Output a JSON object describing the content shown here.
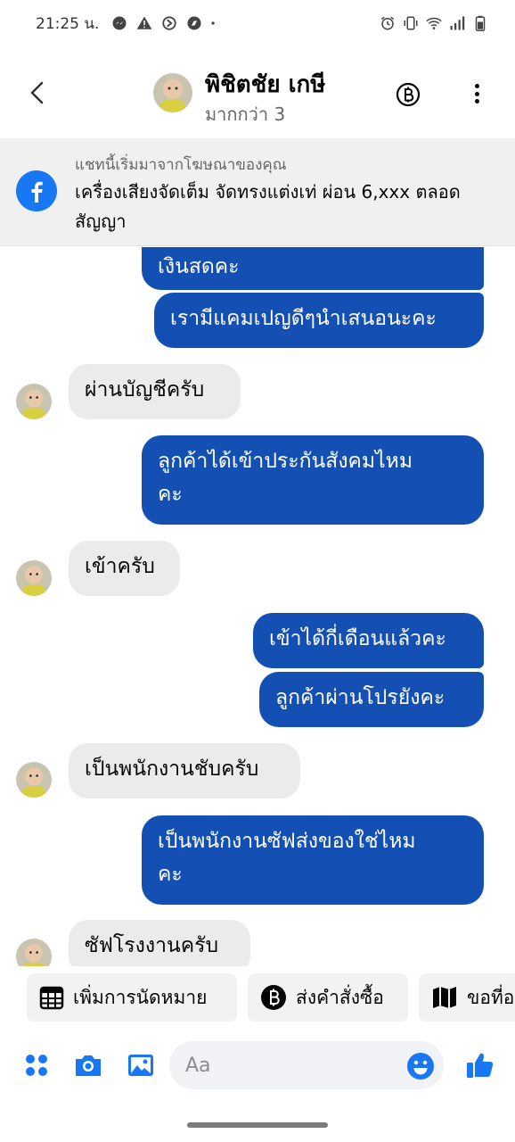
{
  "status_bar": {
    "time": "21:25 น.",
    "left_icons": [
      "messenger-icon",
      "warning-icon",
      "data-saver-icon",
      "compass-icon",
      "dot-icon"
    ],
    "right_icons": [
      "alarm-icon",
      "vibrate-icon",
      "wifi-icon",
      "signal-icon",
      "battery-icon"
    ]
  },
  "header": {
    "name": "พิชิตชัย เกษี",
    "subtitle": "มากกว่า 3"
  },
  "ad_banner": {
    "origin": "แชทนี้เริ่มมาจากโฆษณาของคุณ",
    "title": "เครื่องเสียงจัดเต็ม จัดทรงแต่งเท่ ผ่อน 6,xxx ตลอดสัญญา"
  },
  "messages": [
    {
      "sender": "me",
      "text": "เงินสดคะ"
    },
    {
      "sender": "me",
      "text": "เรามีแคมเปญดีๆนำเสนอนะคะ"
    },
    {
      "sender": "other",
      "text": "ผ่านบัญชีครับ"
    },
    {
      "sender": "me",
      "line1": "ลูกค้าได้เข้าประกันสังคมไหม",
      "line2": "คะ"
    },
    {
      "sender": "other",
      "text": "เข้าครับ"
    },
    {
      "sender": "me",
      "text": "เข้าได้กี่เดือนแล้วคะ"
    },
    {
      "sender": "me",
      "text": "ลูกค้าผ่านโปรยังคะ"
    },
    {
      "sender": "other",
      "text": "เป็นพนักงานชับครับ"
    },
    {
      "sender": "me",
      "line1": "เป็นพนักงานซัฟส่งของใช่ไหม",
      "line2": "คะ"
    },
    {
      "sender": "other",
      "text": "ซัฟโรงงานครับ"
    }
  ],
  "quick_replies": [
    {
      "label": "เพิ่มการนัดหมาย",
      "icon": "calendar-icon"
    },
    {
      "label": "ส่งคำสั่งซื้อ",
      "icon": "baht-icon"
    },
    {
      "label": "ขอที่อ",
      "icon": "map-icon"
    }
  ],
  "composer": {
    "placeholder": "Aa",
    "icons": [
      "apps-icon",
      "camera-icon",
      "gallery-icon",
      "emoji-icon",
      "like-icon"
    ]
  },
  "colors": {
    "accent": "#1877f2",
    "outgoing_bubble": "#1450b4",
    "incoming_bubble": "#ebebeb"
  }
}
